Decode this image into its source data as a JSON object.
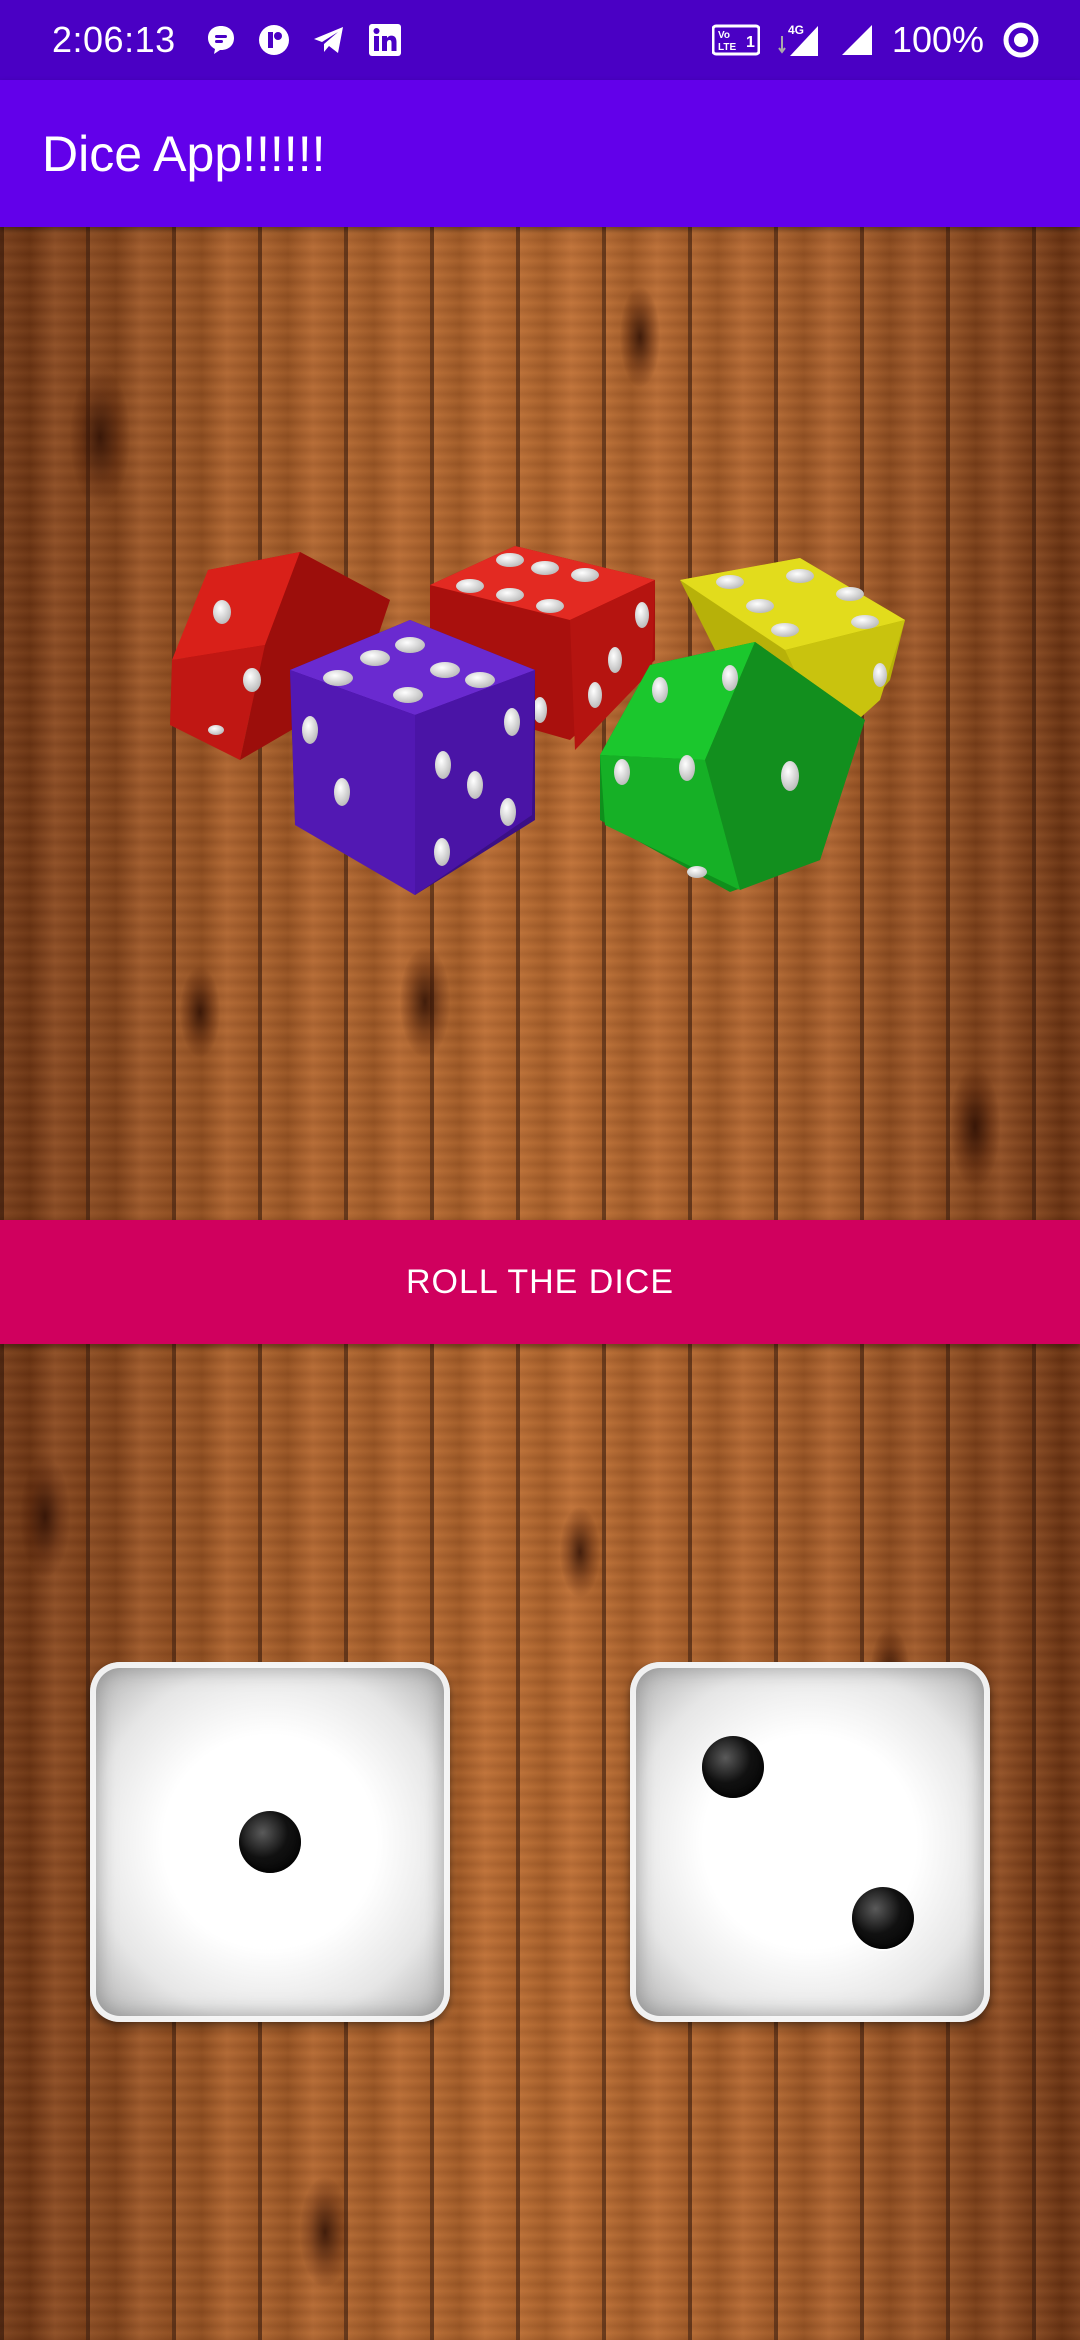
{
  "status_bar": {
    "time": "2:06:13",
    "network_label": "4G",
    "volte_label": "Vo LTE 1",
    "battery_percent": "100%",
    "left_icons": [
      "chat-bubble-icon",
      "app-badge-icon",
      "telegram-icon",
      "linkedin-icon"
    ],
    "right_icons": [
      "volte-icon",
      "network-4g-icon",
      "signal-icon",
      "battery-ring-icon"
    ]
  },
  "app_bar": {
    "title": "Dice App!!!!!!",
    "color": "#6200ea"
  },
  "hero": {
    "image_name": "dice-group-image",
    "dice_colors": [
      "#cc1a14",
      "#d21b17",
      "#d4cf12",
      "#5a16b8",
      "#1fb52e"
    ]
  },
  "roll_button": {
    "label": "ROLL THE DICE",
    "color": "#d0005e"
  },
  "results": {
    "die_left_value": 1,
    "die_right_value": 2
  }
}
